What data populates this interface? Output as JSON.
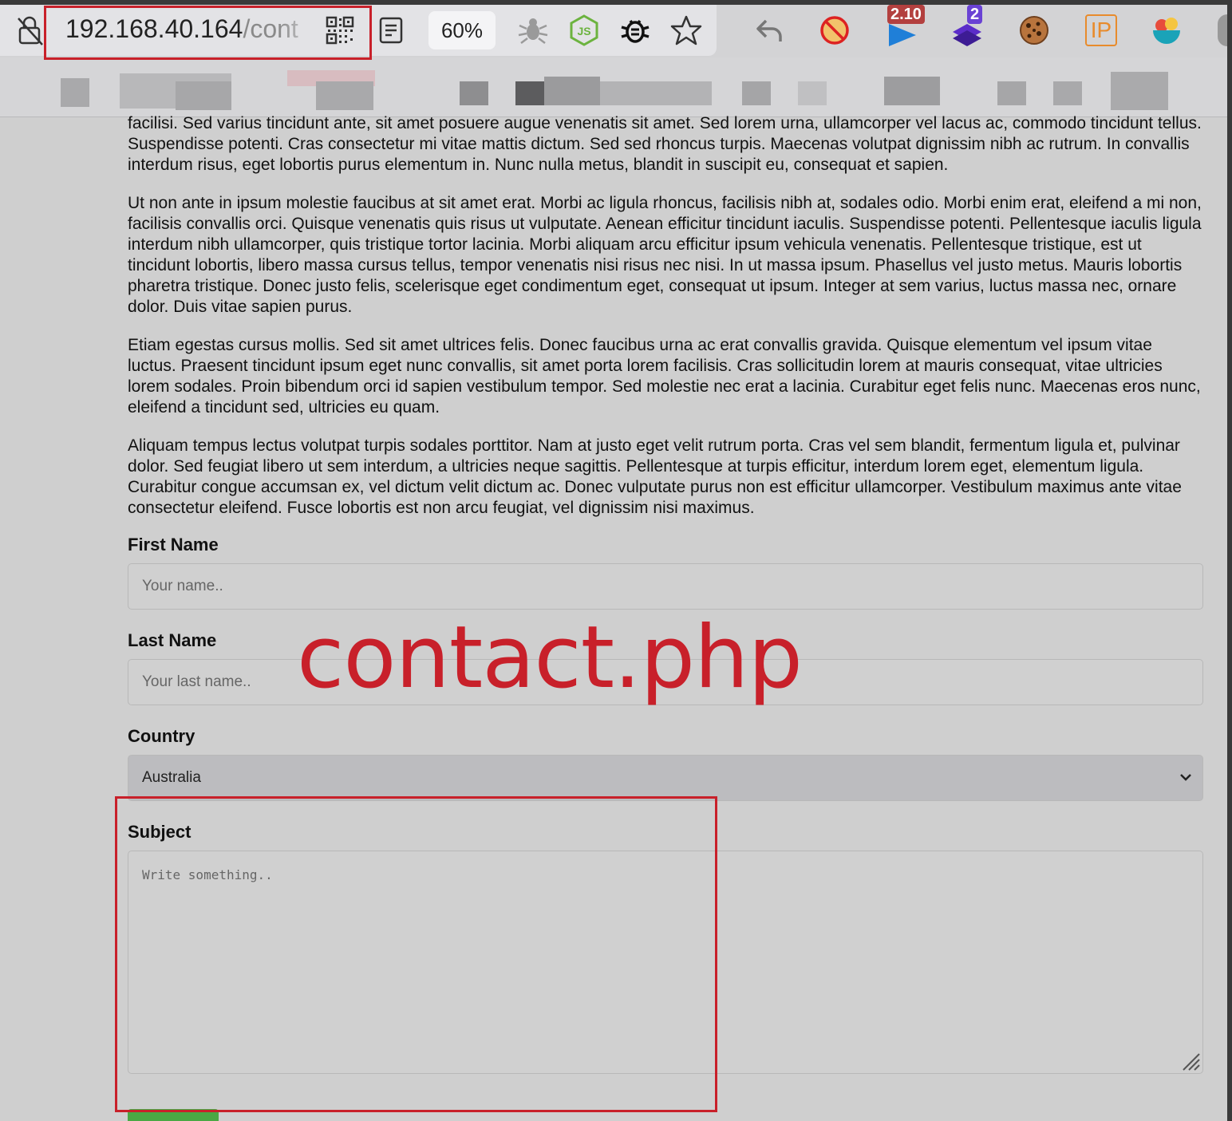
{
  "browser": {
    "url_host": "192.168.40.164",
    "url_path": "/cont",
    "zoom": "60%",
    "badges": {
      "ext_blue": "2.10",
      "ext_purple": "2"
    },
    "ip_ext_label": "IP"
  },
  "content": {
    "paragraphs": [
      "facilisi. Sed varius tincidunt ante, sit amet posuere augue venenatis sit amet. Sed lorem urna, ullamcorper vel lacus ac, commodo tincidunt tellus. Suspendisse potenti. Cras consectetur mi vitae mattis dictum. Sed sed rhoncus turpis. Maecenas volutpat dignissim nibh ac rutrum. In convallis interdum risus, eget lobortis purus elementum in. Nunc nulla metus, blandit in suscipit eu, consequat et sapien.",
      "Ut non ante in ipsum molestie faucibus at sit amet erat. Morbi ac ligula rhoncus, facilisis nibh at, sodales odio. Morbi enim erat, eleifend a mi non, facilisis convallis orci. Quisque venenatis quis risus ut vulputate. Aenean efficitur tincidunt iaculis. Suspendisse potenti. Pellentesque iaculis ligula interdum nibh ullamcorper, quis tristique tortor lacinia. Morbi aliquam arcu efficitur ipsum vehicula venenatis. Pellentesque tristique, est ut tincidunt lobortis, libero massa cursus tellus, tempor venenatis nisi risus nec nisi. In ut massa ipsum. Phasellus vel justo metus. Mauris lobortis pharetra tristique. Donec justo felis, scelerisque eget condimentum eget, consequat ut ipsum. Integer at sem varius, luctus massa nec, ornare dolor. Duis vitae sapien purus.",
      "Etiam egestas cursus mollis. Sed sit amet ultrices felis. Donec faucibus urna ac erat convallis gravida. Quisque elementum vel ipsum vitae luctus. Praesent tincidunt ipsum eget nunc convallis, sit amet porta lorem facilisis. Cras sollicitudin lorem at mauris consequat, vitae ultricies lorem sodales. Proin bibendum orci id sapien vestibulum tempor. Sed molestie nec erat a lacinia. Curabitur eget felis nunc. Maecenas eros nunc, eleifend a tincidunt sed, ultricies eu quam.",
      "Aliquam tempus lectus volutpat turpis sodales porttitor. Nam at justo eget velit rutrum porta. Cras vel sem blandit, fermentum ligula et, pulvinar dolor. Sed feugiat libero ut sem interdum, a ultricies neque sagittis. Pellentesque at turpis efficitur, interdum lorem eget, elementum ligula. Curabitur congue accumsan ex, vel dictum velit dictum ac. Donec vulputate purus non est efficitur ullamcorper. Vestibulum maximus ante vitae consectetur eleifend. Fusce lobortis est non arcu feugiat, vel dignissim nisi maximus."
    ]
  },
  "form": {
    "first_name_label": "First Name",
    "first_name_placeholder": "Your name..",
    "last_name_label": "Last Name",
    "last_name_placeholder": "Your last name..",
    "country_label": "Country",
    "country_selected": "Australia",
    "subject_label": "Subject",
    "subject_placeholder": "Write something.."
  },
  "annotation": {
    "overlay_text": "contact.php",
    "color": "#c8202a"
  }
}
